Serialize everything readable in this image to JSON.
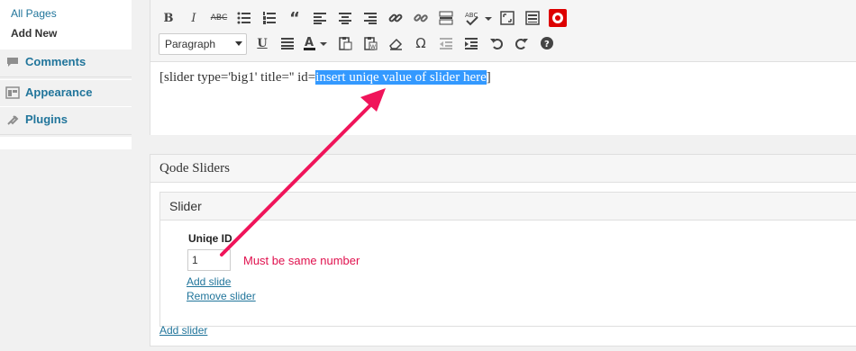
{
  "sidebar": {
    "submenu": {
      "all_pages": "All Pages",
      "add_new": "Add New"
    },
    "menu": [
      {
        "label": "Comments",
        "icon": "comments-icon"
      },
      {
        "label": "Appearance",
        "icon": "appearance-icon"
      },
      {
        "label": "Plugins",
        "icon": "plugins-icon"
      }
    ]
  },
  "editor": {
    "format_select": "Paragraph",
    "content_before": "[slider type='big1' title='' id=",
    "content_selected": "insert uniqe value of slider here",
    "content_after": "]"
  },
  "qode": {
    "panel_title": "Qode Sliders",
    "slider_title": "Slider",
    "uniq_label": "Uniqe ID",
    "uniq_value": "1",
    "note": "Must be same number",
    "add_slide": "Add slide",
    "remove_slider": "Remove slider",
    "add_slider": "Add slider"
  },
  "colors": {
    "link": "#21759b",
    "annotation": "#e0114e",
    "selection": "#3399ff"
  }
}
